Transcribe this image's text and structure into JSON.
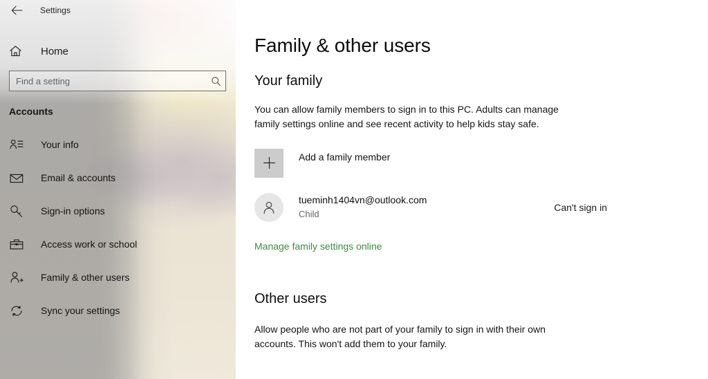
{
  "window": {
    "title": "Settings",
    "back_icon": "back-arrow-icon"
  },
  "sidebar": {
    "home": {
      "label": "Home",
      "icon": "home-icon"
    },
    "search": {
      "placeholder": "Find a setting",
      "value": "",
      "icon": "search-icon"
    },
    "category": "Accounts",
    "items": [
      {
        "label": "Your info",
        "icon": "user-info-icon"
      },
      {
        "label": "Email & accounts",
        "icon": "envelope-icon"
      },
      {
        "label": "Sign-in options",
        "icon": "key-icon"
      },
      {
        "label": "Access work or school",
        "icon": "briefcase-icon"
      },
      {
        "label": "Family & other users",
        "icon": "user-add-icon"
      },
      {
        "label": "Sync your settings",
        "icon": "sync-icon"
      }
    ]
  },
  "main": {
    "page_title": "Family & other users",
    "your_family": {
      "title": "Your family",
      "description": "You can allow family members to sign in to this PC. Adults can manage family settings online and see recent activity to help kids stay safe.",
      "add_member": {
        "label": "Add a family member",
        "icon": "plus-icon"
      },
      "members": [
        {
          "name": "tueminh1404vn@outlook.com",
          "role": "Child",
          "status": "Can't sign in",
          "avatar_icon": "person-avatar-icon"
        }
      ],
      "manage_link": "Manage family settings online"
    },
    "other_users": {
      "title": "Other users",
      "description": "Allow people who are not part of your family to sign in with their own accounts. This won't add them to your family."
    }
  },
  "colors": {
    "link_green": "#3e8b3e",
    "sidebar_tint": "#848486",
    "plus_box": "#cccccc",
    "avatar_bg": "#e6e6e6"
  }
}
